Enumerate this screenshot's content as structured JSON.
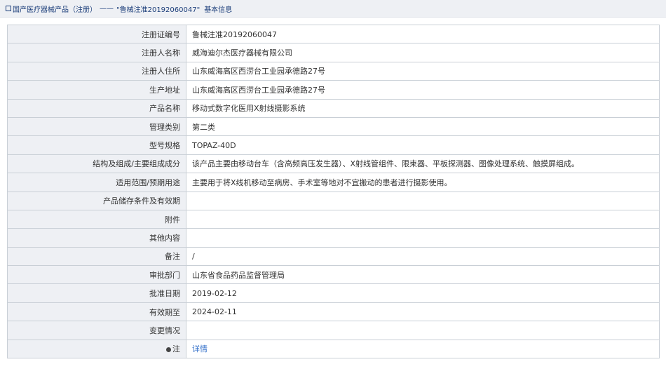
{
  "breadcrumb": {
    "root": "国产医疗器械产品（注册）",
    "separator": "——",
    "current": "\"鲁械注准20192060047\"",
    "suffix": "基本信息"
  },
  "rows": [
    {
      "label": "注册证编号",
      "value": "鲁械注准20192060047"
    },
    {
      "label": "注册人名称",
      "value": "威海迪尔杰医疗器械有限公司"
    },
    {
      "label": "注册人住所",
      "value": "山东威海高区西涝台工业园承德路27号"
    },
    {
      "label": "生产地址",
      "value": "山东威海高区西涝台工业园承德路27号"
    },
    {
      "label": "产品名称",
      "value": "移动式数字化医用X射线摄影系统"
    },
    {
      "label": "管理类别",
      "value": "第二类"
    },
    {
      "label": "型号规格",
      "value": "TOPAZ-40D"
    },
    {
      "label": "结构及组成/主要组成成分",
      "value": "该产品主要由移动台车（含高频高压发生器）、X射线管组件、限束器、平板探测器、图像处理系统、触摸屏组成。"
    },
    {
      "label": "适用范围/预期用途",
      "value": "主要用于将X线机移动至病房、手术室等地对不宜搬动的患者进行摄影使用。"
    },
    {
      "label": "产品储存条件及有效期",
      "value": ""
    },
    {
      "label": "附件",
      "value": ""
    },
    {
      "label": "其他内容",
      "value": ""
    },
    {
      "label": "备注",
      "value": "/"
    },
    {
      "label": "审批部门",
      "value": "山东省食品药品监督管理局"
    },
    {
      "label": "批准日期",
      "value": "2019-02-12"
    },
    {
      "label": "有效期至",
      "value": "2024-02-11"
    },
    {
      "label": "变更情况",
      "value": ""
    },
    {
      "label": "注",
      "value": "详情"
    }
  ],
  "colors": {
    "label_bg": "#eef0f4",
    "border": "#c9cfd6",
    "link": "#2f6dc8",
    "breadcrumb": "#1c3e7a"
  },
  "icons": {
    "breadcrumb": "page-icon",
    "note": "bulb-icon"
  }
}
